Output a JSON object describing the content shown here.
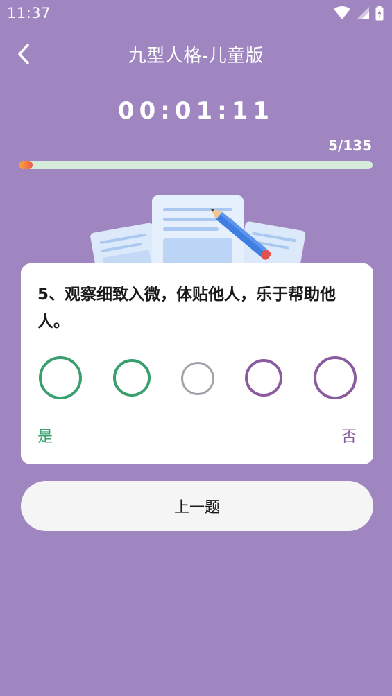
{
  "status_bar": {
    "time": "11:37",
    "icons": [
      "wifi-icon",
      "signal-icon",
      "battery-icon"
    ]
  },
  "header": {
    "back_icon": "chevron-left-icon",
    "title": "九型人格-儿童版"
  },
  "timer": {
    "value": "00:01:11"
  },
  "progress": {
    "label": "5/135",
    "current": 5,
    "total": 135,
    "fill_color": "#f6a43a",
    "track_color": "#d4ecd9"
  },
  "question": {
    "text": "5、观察细致入微，体贴他人，乐于帮助他人。",
    "options": [
      {
        "color": "#3a9f6e"
      },
      {
        "color": "#3a9f6e"
      },
      {
        "color": "#a3a3ab"
      },
      {
        "color": "#8a5c9e"
      },
      {
        "color": "#8a5c9e"
      }
    ],
    "yes_label": "是",
    "no_label": "否"
  },
  "actions": {
    "previous_label": "上一题"
  },
  "colors": {
    "background": "#a086c0",
    "card": "#ffffff",
    "button": "#f5f5f5"
  }
}
